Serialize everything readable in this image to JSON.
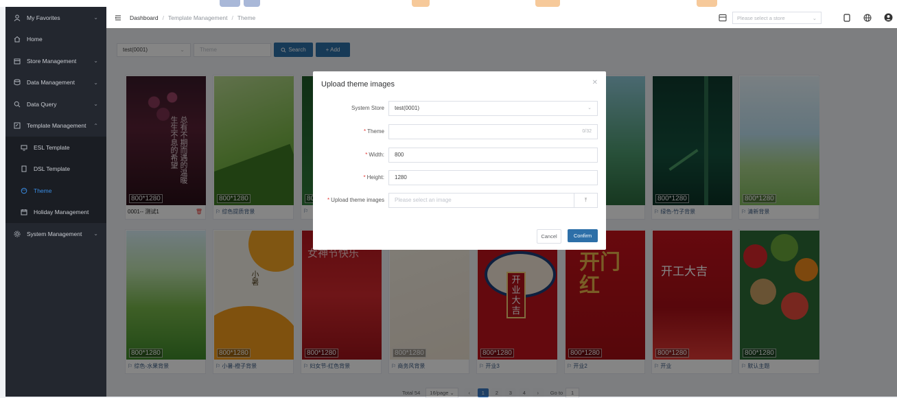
{
  "colors": {
    "sidebar": "#23272f",
    "accent": "#3a8ee6",
    "primary_button": "#2d6fa8",
    "required": "#e53935"
  },
  "sidebar": {
    "items": [
      {
        "label": "My Favorites",
        "icon": "user-icon",
        "has_arrow": true
      },
      {
        "label": "Home",
        "icon": "home-icon",
        "has_arrow": false
      },
      {
        "label": "Store Management",
        "icon": "store-icon",
        "has_arrow": true
      },
      {
        "label": "Data Management",
        "icon": "database-icon",
        "has_arrow": true
      },
      {
        "label": "Data Query",
        "icon": "search-icon",
        "has_arrow": true
      },
      {
        "label": "Template Management",
        "icon": "template-icon",
        "has_arrow": true
      }
    ],
    "sub_items": [
      {
        "label": "ESL Template",
        "icon": "esl-icon"
      },
      {
        "label": "DSL Template",
        "icon": "dsl-icon"
      },
      {
        "label": "Theme",
        "icon": "theme-icon",
        "active": true
      },
      {
        "label": "Holiday Management",
        "icon": "calendar-icon"
      }
    ],
    "bottom_item": {
      "label": "System Management",
      "icon": "settings-icon"
    }
  },
  "header": {
    "breadcrumb": [
      "Dashboard",
      "Template Management",
      "Theme"
    ],
    "store_placeholder": "Please select a store"
  },
  "toolbar": {
    "store_value": "test(0001)",
    "theme_placeholder": "Theme",
    "search_label": "Search",
    "add_label": "+ Add"
  },
  "themes": [
    {
      "size": "800*1280",
      "name": "0001-- 测试1",
      "deletable": true
    },
    {
      "size": "800*1280",
      "name": "综色提质背景"
    },
    {
      "size": "800*1280",
      "name": ""
    },
    {
      "size": "",
      "name": ""
    },
    {
      "size": "",
      "name": ""
    },
    {
      "size": "",
      "name": ""
    },
    {
      "size": "800*1280",
      "name": "绿色-竹子背景"
    },
    {
      "size": "800*1280",
      "name": "清新背景"
    },
    {
      "size": "800*1280",
      "name": "综色-水果背景"
    },
    {
      "size": "800*1280",
      "name": "小暑-橙子背景"
    },
    {
      "size": "800*1280",
      "name": "妇女节-红色背景"
    },
    {
      "size": "800*1280",
      "name": "商务风背景"
    },
    {
      "size": "800*1280",
      "name": "开业3"
    },
    {
      "size": "800*1280",
      "name": "开业2"
    },
    {
      "size": "800*1280",
      "name": "开业"
    },
    {
      "size": "800*1280",
      "name": "默认主题"
    }
  ],
  "image_text": {
    "poem": "总有不期而遇的温暖 生生不息的希望",
    "women_day": "女神节快乐",
    "summer": "小暑",
    "kaiye": "开业大吉",
    "kaimen": "开门红",
    "kaigong": "开工大吉"
  },
  "modal": {
    "title": "Upload theme images",
    "fields": [
      {
        "label": "System Store",
        "required": false,
        "value": "test(0001)",
        "placeholder": ""
      },
      {
        "label": "Theme",
        "required": true,
        "value": "",
        "counter": "0/32"
      },
      {
        "label": "Width:",
        "required": true,
        "value": "800"
      },
      {
        "label": "Height:",
        "required": true,
        "value": "1280"
      },
      {
        "label": "Upload theme images",
        "required": true,
        "value": "",
        "placeholder": "Please select an image"
      }
    ],
    "cancel_label": "Cancel",
    "confirm_label": "Confirm"
  },
  "pagination": {
    "total": "Total 54",
    "page_size": "16/page",
    "pages": [
      "1",
      "2",
      "3",
      "4"
    ],
    "current": "1",
    "goto_label": "Go to",
    "goto_value": "1"
  }
}
